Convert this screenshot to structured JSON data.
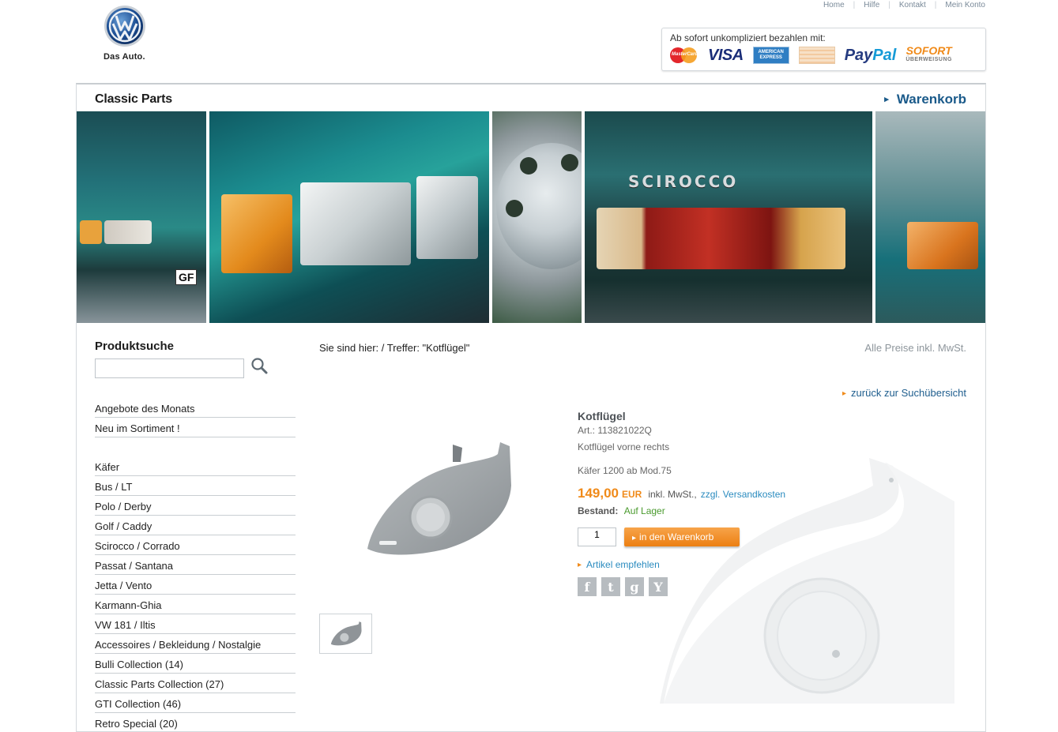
{
  "header": {
    "logo_text": "Das Auto.",
    "nav": [
      "Home",
      "Hilfe",
      "Kontakt",
      "Mein Konto"
    ],
    "payment": {
      "title": "Ab sofort unkompliziert bezahlen mit:",
      "mastercard": "MasterCard",
      "visa": "VISA",
      "amex": "AMERICAN EXPRESS",
      "paypal_a": "Pay",
      "paypal_b": "Pal",
      "sofort": "SOFORT",
      "sofort_sub": "ÜBERWEISUNG"
    }
  },
  "bar": {
    "brand": "Classic Parts",
    "cart": "Warenkorb"
  },
  "banner": {
    "plate": "GF",
    "model_badge": "SCIROCCO"
  },
  "sidebar": {
    "search_title": "Produktsuche",
    "search_value": "",
    "menu_top": [
      "Angebote des Monats",
      "Neu im Sortiment !"
    ],
    "menu_categories": [
      "Käfer",
      "Bus / LT",
      "Polo / Derby",
      "Golf / Caddy",
      "Scirocco / Corrado",
      "Passat / Santana",
      "Jetta / Vento",
      "Karmann-Ghia",
      "VW 181 / Iltis",
      "Accessoires / Bekleidung / Nostalgie",
      "Bulli Collection (14)",
      "Classic Parts Collection (27)",
      "GTI Collection (46)",
      "Retro Special (20)"
    ]
  },
  "content": {
    "breadcrumb": "Sie sind hier: / Treffer: \"Kotflügel\"",
    "prices_note": "Alle Preise inkl. MwSt.",
    "back_link": "zurück zur Suchübersicht"
  },
  "product": {
    "title": "Kotflügel",
    "article": "Art.: 113821022Q",
    "description": "Kotflügel vorne rechts",
    "fitment": "Käfer 1200 ab Mod.75",
    "price": "149,00",
    "currency": "EUR",
    "vat_text": "inkl. MwSt.,",
    "shipping_link": "zzgl. Versandkosten",
    "stock_label": "Bestand:",
    "stock_value": "Auf Lager",
    "quantity": "1",
    "add_to_cart": "in den Warenkorb",
    "recommend_link": "Artikel empfehlen",
    "social": [
      "f",
      "t",
      "g",
      "Y"
    ]
  },
  "colors": {
    "accent_orange": "#f08a19",
    "link_blue": "#2a8bbf",
    "brand_blue": "#1a5a8a",
    "stock_green": "#4a9a2e"
  }
}
